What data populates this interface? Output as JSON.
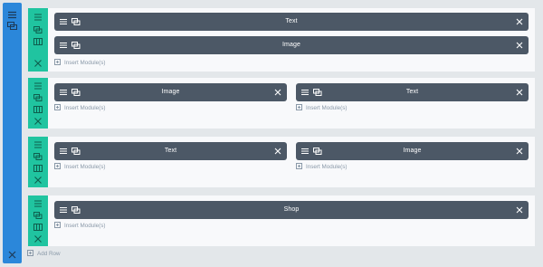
{
  "section": {
    "icons": [
      "hamburger-icon",
      "duplicate-icon",
      "close-icon"
    ]
  },
  "rows": [
    {
      "columns": [
        {
          "modules": [
            {
              "label": "Text"
            },
            {
              "label": "Image"
            }
          ],
          "insert_label": "Insert Module(s)"
        }
      ]
    },
    {
      "columns": [
        {
          "modules": [
            {
              "label": "Image"
            }
          ],
          "insert_label": "Insert Module(s)"
        },
        {
          "modules": [
            {
              "label": "Text"
            }
          ],
          "insert_label": "Insert Module(s)"
        }
      ]
    },
    {
      "columns": [
        {
          "modules": [
            {
              "label": "Text"
            }
          ],
          "insert_label": "Insert Module(s)"
        },
        {
          "modules": [
            {
              "label": "Image"
            }
          ],
          "insert_label": "Insert Module(s)"
        }
      ]
    },
    {
      "columns": [
        {
          "modules": [
            {
              "label": "Shop"
            }
          ],
          "insert_label": "Insert Module(s)"
        }
      ]
    }
  ],
  "add_row_label": "Add Row",
  "colors": {
    "section_bar": "#2b87da",
    "row_bar": "#20c4a0",
    "module": "#4c5866",
    "background": "#e3e7ea"
  }
}
